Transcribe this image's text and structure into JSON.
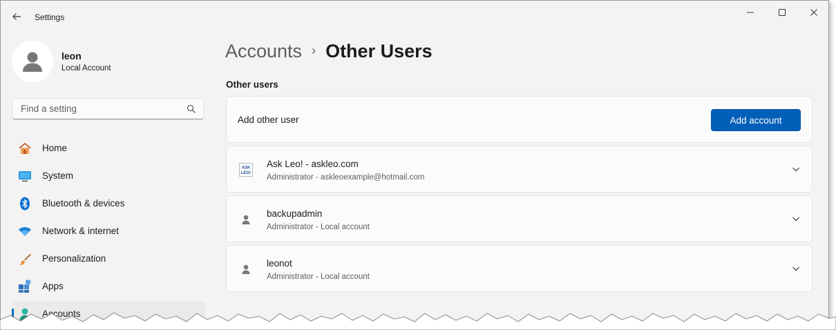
{
  "window": {
    "title": "Settings"
  },
  "profile": {
    "name": "leon",
    "account_type": "Local Account"
  },
  "search": {
    "placeholder": "Find a setting"
  },
  "sidebar": {
    "items": [
      {
        "label": "Home",
        "icon": "home-icon"
      },
      {
        "label": "System",
        "icon": "system-icon"
      },
      {
        "label": "Bluetooth & devices",
        "icon": "bluetooth-icon"
      },
      {
        "label": "Network & internet",
        "icon": "wifi-icon"
      },
      {
        "label": "Personalization",
        "icon": "brush-icon"
      },
      {
        "label": "Apps",
        "icon": "apps-icon"
      },
      {
        "label": "Accounts",
        "icon": "accounts-icon",
        "active": true
      }
    ]
  },
  "breadcrumb": {
    "parent": "Accounts",
    "separator": "›",
    "current": "Other Users"
  },
  "section": {
    "title": "Other users"
  },
  "add_user": {
    "label": "Add other user",
    "button_label": "Add account"
  },
  "users": [
    {
      "name": "Ask Leo! - askleo.com",
      "detail": "Administrator - askleoexample@hotmail.com",
      "icon": "askleo-logo-icon",
      "logo_text": "ASK LEO!"
    },
    {
      "name": "backupadmin",
      "detail": "Administrator - Local account",
      "icon": "person-icon"
    },
    {
      "name": "leonot",
      "detail": "Administrator - Local account",
      "icon": "person-icon"
    }
  ],
  "colors": {
    "accent": "#005fb8",
    "background": "#f3f3f3",
    "card": "#fbfbfb"
  }
}
